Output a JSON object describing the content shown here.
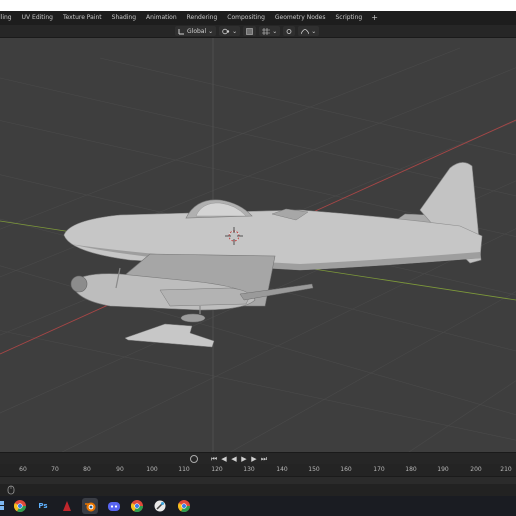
{
  "workspace_tabs": [
    {
      "label": "lling"
    },
    {
      "label": "UV Editing"
    },
    {
      "label": "Texture Paint"
    },
    {
      "label": "Shading"
    },
    {
      "label": "Animation"
    },
    {
      "label": "Rendering"
    },
    {
      "label": "Compositing"
    },
    {
      "label": "Geometry Nodes"
    },
    {
      "label": "Scripting"
    }
  ],
  "workspace_add": "+",
  "header": {
    "transform_orientation": "Global"
  },
  "timeline": {
    "frame_labels": [
      "60",
      "70",
      "80",
      "90",
      "100",
      "110",
      "120",
      "130",
      "140",
      "150",
      "160",
      "170",
      "180",
      "190",
      "200",
      "210"
    ]
  },
  "taskbar": {
    "apps": [
      {
        "name": "chrome-icon"
      },
      {
        "name": "photoshop-icon",
        "text": "Ps"
      },
      {
        "name": "red-app-icon"
      },
      {
        "name": "blender-icon"
      },
      {
        "name": "discord-icon"
      },
      {
        "name": "chrome-icon-2"
      },
      {
        "name": "krita-icon"
      },
      {
        "name": "chrome-icon-3"
      }
    ]
  },
  "colors": {
    "viewport_bg": "#3e3e3e",
    "grid": "#4a4a4a",
    "axis_x": "#b04848",
    "axis_y": "#7e9a3a",
    "model": "#bcbcbc"
  }
}
